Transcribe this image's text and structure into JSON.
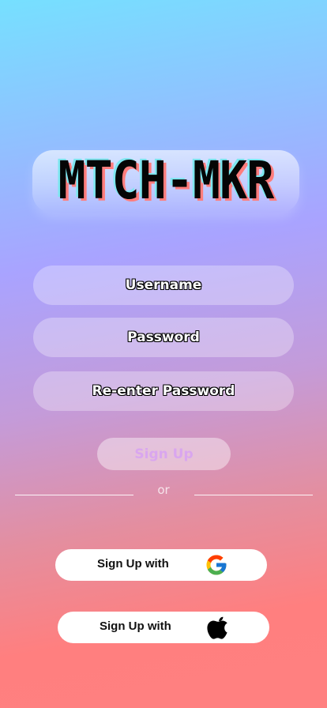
{
  "app": {
    "logo_text": "MTCH-MKR"
  },
  "form": {
    "username_label": "Username",
    "password_label": "Password",
    "reenter_password_label": "Re-enter Password",
    "signup_label": "Sign Up"
  },
  "divider": {
    "text": "or"
  },
  "social": {
    "google_label": "Sign Up with",
    "google_icon": "google-icon",
    "apple_label": "Sign Up with",
    "apple_icon": "apple-icon"
  },
  "colors": {
    "gradient_top": "#76e0ff",
    "gradient_mid": "#a9a3ff",
    "gradient_bottom": "#ff7f7f",
    "signup_text": "#d9a6ef"
  }
}
